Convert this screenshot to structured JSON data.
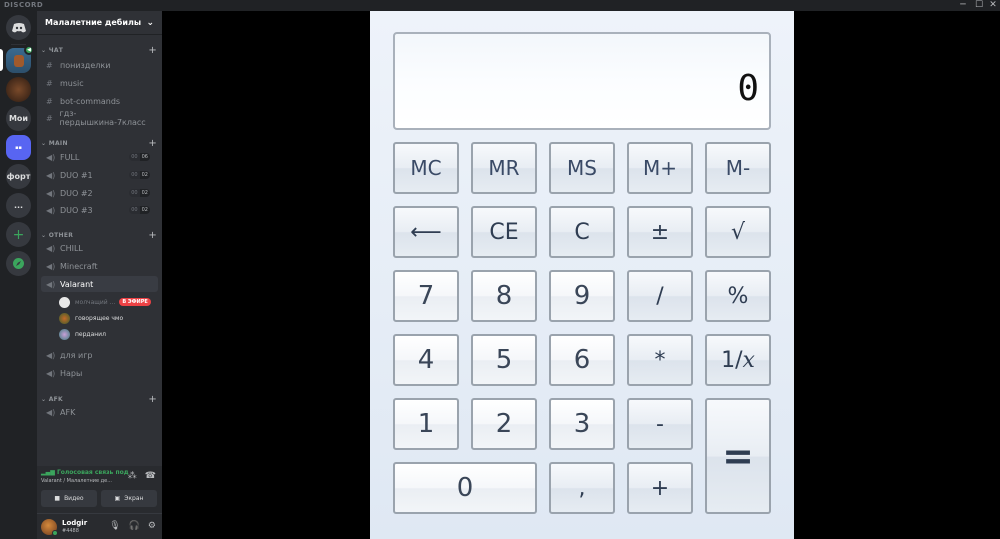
{
  "titlebar": {
    "brand": "DISCORD",
    "minimize": "─",
    "maximize": "☐",
    "close": "✕"
  },
  "guilds": [
    {
      "label": "",
      "kind": "home",
      "icon": "discord-logo-icon"
    },
    {
      "label": "",
      "kind": "image",
      "selected": true,
      "badge": "speaker-icon"
    },
    {
      "label": "",
      "kind": "image"
    },
    {
      "label": "Мои",
      "kind": "text"
    },
    {
      "label": "",
      "kind": "folder"
    },
    {
      "label": "форт",
      "kind": "text"
    },
    {
      "label": "...",
      "kind": "text"
    },
    {
      "label": "+",
      "kind": "add",
      "icon": "plus-icon"
    },
    {
      "label": "",
      "kind": "explore",
      "icon": "compass-icon"
    }
  ],
  "server": {
    "name": "Малалетние дебилы",
    "chevron": "⌄"
  },
  "categories": {
    "chat": {
      "label": "ЧАТ",
      "channels": [
        {
          "name": "понизделки",
          "type": "text"
        },
        {
          "name": "music",
          "type": "text"
        },
        {
          "name": "bot-commands",
          "type": "text"
        },
        {
          "name": "гдз-пердышкина-7класс",
          "type": "text"
        }
      ]
    },
    "main": {
      "label": "MAIN",
      "channels": [
        {
          "name": "FULL",
          "type": "voice",
          "count": "00",
          "limit": "06"
        },
        {
          "name": "DUO #1",
          "type": "voice",
          "count": "00",
          "limit": "02"
        },
        {
          "name": "DUO #2",
          "type": "voice",
          "count": "00",
          "limit": "02"
        },
        {
          "name": "DUO #3",
          "type": "voice",
          "count": "00",
          "limit": "02"
        }
      ]
    },
    "other": {
      "label": "OTHER",
      "channels": [
        {
          "name": "CHILL",
          "type": "voice"
        },
        {
          "name": "Minecraft",
          "type": "voice"
        },
        {
          "name": "Valarant",
          "type": "voice",
          "active": true
        },
        {
          "name": "для игр",
          "type": "voice-locked"
        },
        {
          "name": "Нары",
          "type": "voice-locked"
        }
      ],
      "voice_users": [
        {
          "name": "молчащий ...",
          "live": "В ЭФИРЕ",
          "dim": true
        },
        {
          "name": "говорящее чмо"
        },
        {
          "name": "перданил"
        }
      ]
    },
    "afk": {
      "label": "AFK",
      "channels": [
        {
          "name": "AFK",
          "type": "voice"
        }
      ]
    }
  },
  "voice_panel": {
    "status": "Голосовая связь под",
    "sub": "Valarant / Малалетние де...",
    "video": "Видео",
    "screen": "Экран"
  },
  "user": {
    "name": "Lodgir",
    "tag": "#4488"
  },
  "calculator": {
    "display": "0",
    "rows": [
      [
        "MC",
        "MR",
        "MS",
        "M+",
        "M-"
      ],
      [
        "⟵",
        "CE",
        "C",
        "±",
        "√"
      ],
      [
        "7",
        "8",
        "9",
        "/",
        "%"
      ],
      [
        "4",
        "5",
        "6",
        "*",
        "1/x"
      ],
      [
        "1",
        "2",
        "3",
        "-",
        "="
      ],
      [
        "0",
        ",",
        "+"
      ]
    ]
  },
  "colors": {
    "discord_bg": "#36393f",
    "sidebar_bg": "#2f3136",
    "guild_bg": "#202225",
    "online_green": "#3ba55d",
    "live_red": "#ed4245",
    "calc_bg": "#e6edf6"
  }
}
